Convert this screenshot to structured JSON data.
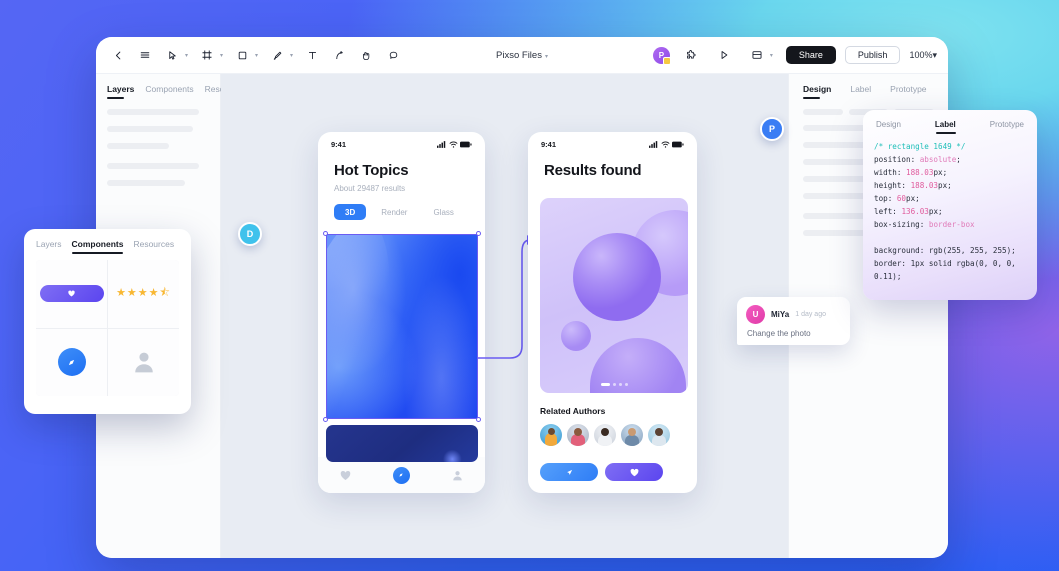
{
  "toolbar": {
    "title": "Pixso Files",
    "title_caret": "▾",
    "tools": [
      {
        "name": "back-icon",
        "label": "Back"
      },
      {
        "name": "menu-icon",
        "label": "Menu"
      },
      {
        "name": "cursor-icon",
        "label": "Move"
      },
      {
        "name": "frame-icon",
        "label": "Frame"
      },
      {
        "name": "rectangle-icon",
        "label": "Rectangle"
      },
      {
        "name": "pen-icon",
        "label": "Pen"
      },
      {
        "name": "text-icon",
        "label": "Text"
      },
      {
        "name": "path-icon",
        "label": "Path"
      },
      {
        "name": "hand-icon",
        "label": "Hand"
      },
      {
        "name": "comment-icon",
        "label": "Comment"
      }
    ],
    "avatar_initial": "P",
    "share_label": "Share",
    "publish_label": "Publish",
    "zoom_label": "100%",
    "zoom_caret": "▾"
  },
  "left_panel": {
    "tabs": [
      {
        "label": "Layers",
        "active": true
      },
      {
        "label": "Components",
        "active": false
      },
      {
        "label": "Resources",
        "active": false
      }
    ]
  },
  "right_panel": {
    "tabs": [
      {
        "label": "Design",
        "active": true
      },
      {
        "label": "Label",
        "active": false
      },
      {
        "label": "Prototype",
        "active": false
      }
    ]
  },
  "code_panel": {
    "tabs": [
      {
        "label": "Design",
        "active": false
      },
      {
        "label": "Label",
        "active": true
      },
      {
        "label": "Prototype",
        "active": false
      }
    ],
    "comment": "/* rectangle 1649 */",
    "lines": [
      {
        "prop": "position",
        "value": "absolute",
        "unit": ";",
        "type": "kw"
      },
      {
        "prop": "width",
        "value": "188.03",
        "unit": "px;",
        "type": "num"
      },
      {
        "prop": "height",
        "value": "188.03",
        "unit": "px;",
        "type": "num"
      },
      {
        "prop": "top",
        "value": "60",
        "unit": "px;",
        "type": "num"
      },
      {
        "prop": "left",
        "value": "136.03",
        "unit": "px;",
        "type": "num"
      },
      {
        "prop": "box-sizing",
        "value": "border-box",
        "unit": "",
        "type": "kw"
      }
    ],
    "background_line": "background: rgb(255, 255, 255);",
    "border_line": "border: 1px solid rgba(0, 0, 0, 0.11);"
  },
  "phone1": {
    "status_time": "9:41",
    "title": "Hot Topics",
    "subtitle": "About 29487 results",
    "segments": [
      {
        "label": "3D",
        "active": true
      },
      {
        "label": "Render",
        "active": false
      },
      {
        "label": "Glass",
        "active": false
      }
    ],
    "nav": [
      {
        "name": "heart-icon",
        "active": false
      },
      {
        "name": "compass-icon",
        "active": true
      },
      {
        "name": "profile-icon",
        "active": false
      }
    ]
  },
  "phone2": {
    "status_time": "9:41",
    "title": "Results found",
    "related_title": "Related Authors",
    "author_count": 5,
    "actions": [
      {
        "name": "share-button",
        "icon": "share-icon"
      },
      {
        "name": "like-button",
        "icon": "heart-icon"
      }
    ]
  },
  "badges": [
    {
      "initial": "D",
      "color": "#3fc2ec"
    },
    {
      "initial": "P",
      "color": "#3a7df4"
    }
  ],
  "comment": {
    "avatar_initial": "U",
    "author": "MiYa",
    "time": "1 day ago",
    "text": "Change the photo"
  },
  "float_panel": {
    "tabs": [
      {
        "label": "Layers",
        "active": false
      },
      {
        "label": "Components",
        "active": true
      },
      {
        "label": "Resources",
        "active": false
      }
    ],
    "components": [
      {
        "name": "like-pill-component",
        "icon": "heart-icon"
      },
      {
        "name": "rating-component",
        "stars": "★★★★⯪"
      },
      {
        "name": "compass-button-component",
        "icon": "compass-icon"
      },
      {
        "name": "avatar-component",
        "icon": "profile-icon"
      }
    ]
  },
  "colors": {
    "accent_blue": "#2f7df6",
    "accent_purple": "#5b45ef",
    "selection": "#6a5cf2"
  }
}
